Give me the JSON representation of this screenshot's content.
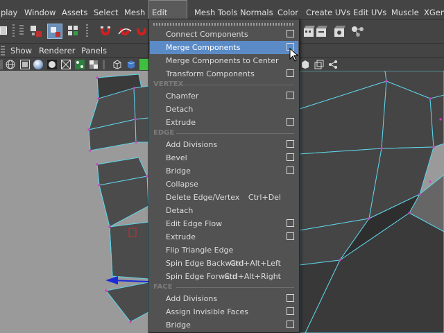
{
  "menubar": {
    "items": [
      "play",
      "Window",
      "Assets",
      "Select",
      "Mesh",
      "Edit Mesh",
      "Mesh Tools",
      "Normals",
      "Color",
      "Create UVs",
      "Edit UVs",
      "Muscle",
      "XGen"
    ],
    "active": "Edit Mesh"
  },
  "panel_menu": {
    "items": [
      "Show",
      "Renderer",
      "Panels"
    ]
  },
  "dropdown": {
    "title": "Edit Mesh",
    "highlighted": "Merge Components",
    "top_items": [
      {
        "label": "Connect Components",
        "option_box": true
      },
      {
        "label": "Merge Components",
        "option_box": true
      },
      {
        "label": "Merge Components to Center",
        "option_box": false
      },
      {
        "label": "Transform Components",
        "option_box": true
      }
    ],
    "sections": [
      {
        "title": "VERTEX",
        "items": [
          {
            "label": "Chamfer",
            "option_box": true
          },
          {
            "label": "Detach",
            "option_box": false
          },
          {
            "label": "Extrude",
            "option_box": true
          }
        ]
      },
      {
        "title": "EDGE",
        "items": [
          {
            "label": "Add Divisions",
            "option_box": true
          },
          {
            "label": "Bevel",
            "option_box": true
          },
          {
            "label": "Bridge",
            "option_box": true
          },
          {
            "label": "Collapse",
            "option_box": false
          },
          {
            "label": "Delete Edge/Vertex",
            "shortcut": "Ctrl+Del",
            "option_box": false
          },
          {
            "label": "Detach",
            "option_box": false
          },
          {
            "label": "Edit Edge Flow",
            "option_box": true
          },
          {
            "label": "Extrude",
            "option_box": true
          },
          {
            "label": "Flip Triangle Edge",
            "option_box": false
          },
          {
            "label": "Spin Edge Backward",
            "shortcut": "Ctrl+Alt+Left",
            "option_box": false
          },
          {
            "label": "Spin Edge Forward",
            "shortcut": "Ctrl+Alt+Right",
            "option_box": false
          }
        ]
      },
      {
        "title": "FACE",
        "items": [
          {
            "label": "Add Divisions",
            "option_box": true
          },
          {
            "label": "Assign Invisible Faces",
            "option_box": true
          },
          {
            "label": "Bridge",
            "option_box": true
          }
        ]
      }
    ]
  },
  "colors": {
    "ui_bg": "#444444",
    "menu_bg": "#525252",
    "highlight": "#5b8bc6",
    "wire": "#5fd3e8",
    "vertex": "#d23cc8",
    "mesh_face": "#4b4b4b",
    "viewport_bg": "#9a9a9a"
  }
}
